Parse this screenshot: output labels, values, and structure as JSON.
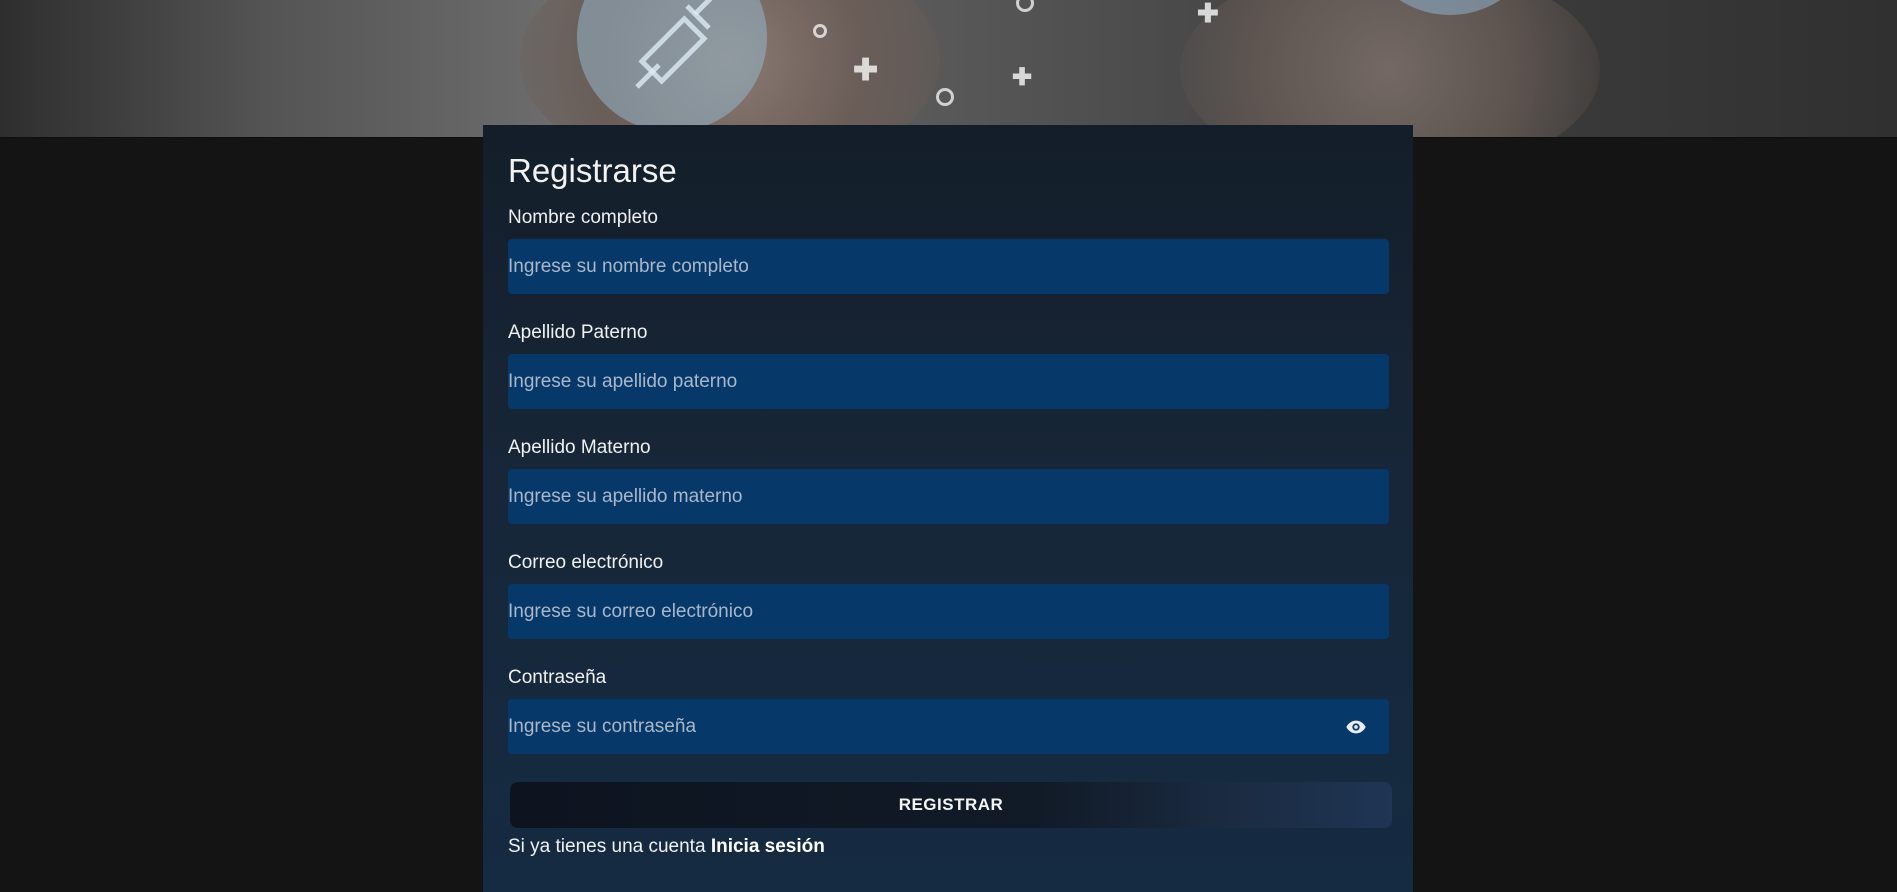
{
  "hero": {
    "image_description_icon": "medical-banner"
  },
  "form": {
    "title": "Registrarse",
    "fields": [
      {
        "label": "Nombre completo",
        "placeholder": "Ingrese su nombre completo",
        "value": ""
      },
      {
        "label": "Apellido Paterno",
        "placeholder": "Ingrese su apellido paterno",
        "value": ""
      },
      {
        "label": "Apellido Materno",
        "placeholder": "Ingrese su apellido materno",
        "value": ""
      },
      {
        "label": "Correo electrónico",
        "placeholder": "Ingrese su correo electrónico",
        "value": ""
      },
      {
        "label": "Contraseña",
        "placeholder": "Ingrese su contraseña",
        "value": ""
      }
    ],
    "password_toggle_icon": "eye-icon",
    "submit_label": "REGISTRAR",
    "login_prompt": "Si ya tienes una cuenta",
    "login_link": "Inicia sesión"
  },
  "colors": {
    "page_background": "#141414",
    "input_background": "#07386a",
    "card_background": "#172638"
  }
}
